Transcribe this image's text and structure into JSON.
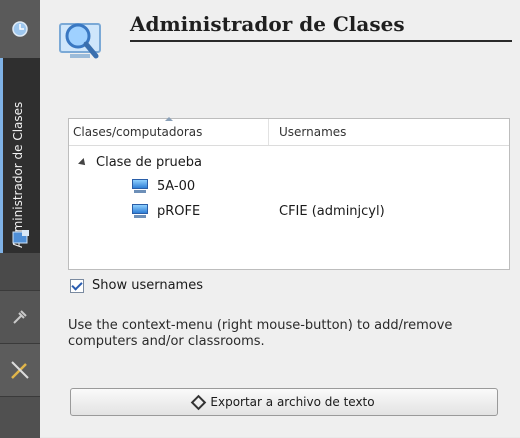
{
  "sidebar": {
    "active_tab_label": "Administrador de Clases",
    "icons": [
      "clock-icon",
      "classroom-admin-icon",
      "tools-icon",
      "wrench-icon"
    ]
  },
  "header": {
    "title": "Administrador de Clases"
  },
  "grid": {
    "columns": [
      "Clases/computadoras",
      "Usernames"
    ],
    "tree": {
      "class_name": "Clase de prueba",
      "computers": [
        {
          "name": "5A-00",
          "username": ""
        },
        {
          "name": "pROFE",
          "username": "CFIE (adminjcyl)"
        }
      ]
    }
  },
  "show_usernames": {
    "label": "Show usernames",
    "checked": true
  },
  "hint": "Use the context-menu (right mouse-button) to add/remove computers and/or classrooms.",
  "export_button": {
    "label": "Exportar a archivo de texto"
  },
  "colors": {
    "sidebar": "#4a4a4a",
    "accent": "#7fb2e6",
    "panel": "#efefef"
  }
}
